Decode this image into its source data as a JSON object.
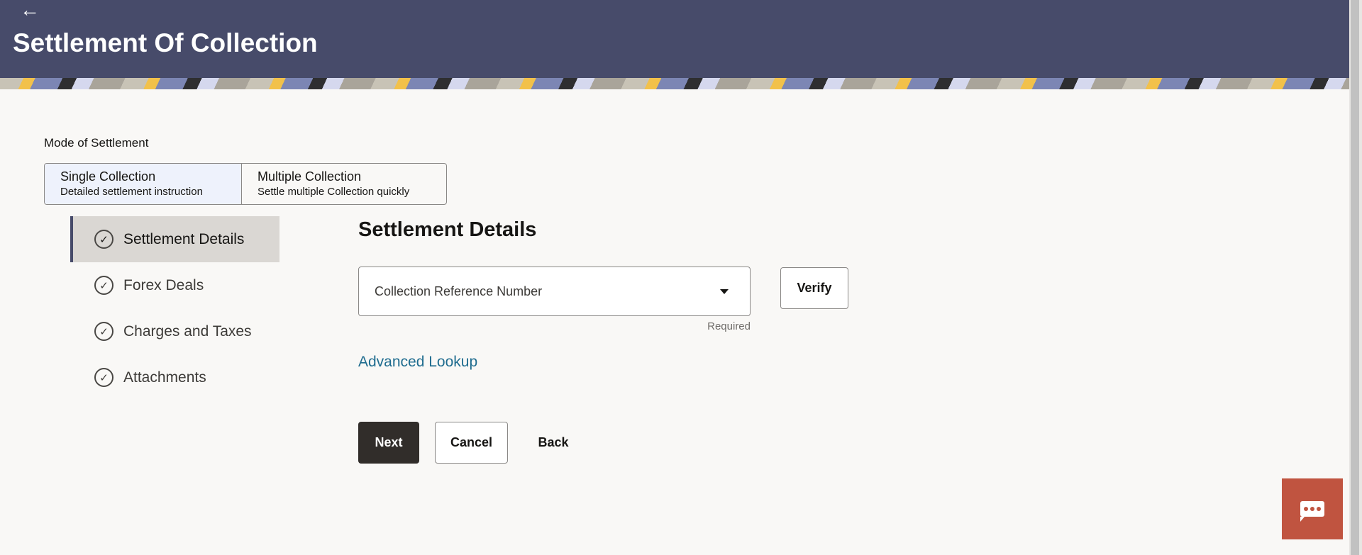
{
  "header": {
    "title": "Settlement Of Collection",
    "back_icon": "arrow-left-icon"
  },
  "mode": {
    "label": "Mode of Settlement",
    "options": [
      {
        "title": "Single Collection",
        "subtitle": "Detailed settlement instruction",
        "selected": true
      },
      {
        "title": "Multiple Collection",
        "subtitle": "Settle multiple Collection quickly",
        "selected": false
      }
    ]
  },
  "steps": [
    {
      "label": "Settlement Details",
      "active": true
    },
    {
      "label": "Forex Deals"
    },
    {
      "label": "Charges and Taxes"
    },
    {
      "label": "Attachments"
    }
  ],
  "form": {
    "heading": "Settlement Details",
    "select_placeholder": "Collection Reference Number",
    "required": "Required",
    "verify": "Verify",
    "advanced_lookup": "Advanced Lookup"
  },
  "actions": {
    "next": "Next",
    "cancel": "Cancel",
    "back": "Back"
  },
  "colors": {
    "header": "#474b6a",
    "chat": "#c05440",
    "link": "#1f6c8f"
  }
}
